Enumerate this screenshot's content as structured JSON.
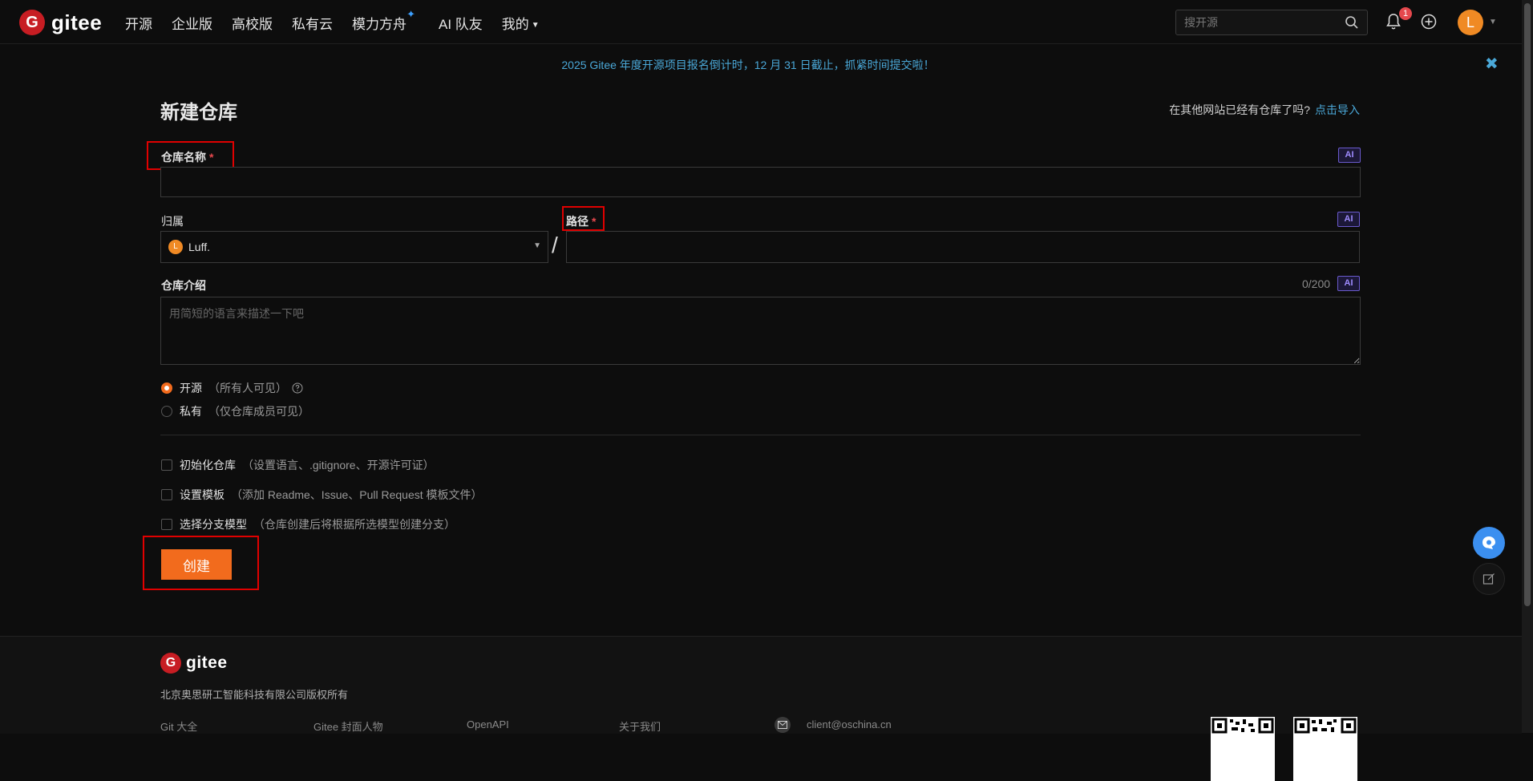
{
  "nav": {
    "logo_text": "gitee",
    "links": [
      "开源",
      "企业版",
      "高校版",
      "私有云",
      "模力方舟",
      "AI 队友",
      "我的"
    ],
    "search_placeholder": "搜开源",
    "notification_count": "1",
    "avatar_letter": "L"
  },
  "banner": {
    "text": "2025 Gitee 年度开源项目报名倒计时，12 月 31 日截止，抓紧时间提交啦！",
    "close": "✖"
  },
  "form": {
    "title": "新建仓库",
    "import_hint": "在其他网站已经有仓库了吗?",
    "import_link": "点击导入",
    "repo_name_label": "仓库名称",
    "required_mark": "*",
    "ai_badge": "AI",
    "owner_label": "归属",
    "owner_value": "Luff.",
    "owner_avatar": "L",
    "path_separator": "/",
    "path_label": "路径",
    "desc_label": "仓库介绍",
    "desc_count": "0/200",
    "desc_placeholder": "用简短的语言来描述一下吧",
    "visibility": [
      {
        "label": "开源",
        "hint": "（所有人可见）",
        "checked": true
      },
      {
        "label": "私有",
        "hint": "（仅仓库成员可见）",
        "checked": false
      }
    ],
    "options": [
      {
        "label": "初始化仓库",
        "hint": "（设置语言、.gitignore、开源许可证）"
      },
      {
        "label": "设置模板",
        "hint": "（添加 Readme、Issue、Pull Request 模板文件）"
      },
      {
        "label": "选择分支模型",
        "hint": "（仓库创建后将根据所选模型创建分支）"
      }
    ],
    "create_button": "创建"
  },
  "footer": {
    "logo_text": "gitee",
    "copyright": "北京奥思研工智能科技有限公司版权所有",
    "links": [
      "Git 大全",
      "Gitee 封面人物",
      "OpenAPI",
      "关于我们"
    ],
    "email": "client@oschina.cn"
  },
  "colors": {
    "accent": "#f26b1d",
    "link": "#4aa8d8",
    "brand": "#c71d23",
    "highlight": "#e00000"
  }
}
